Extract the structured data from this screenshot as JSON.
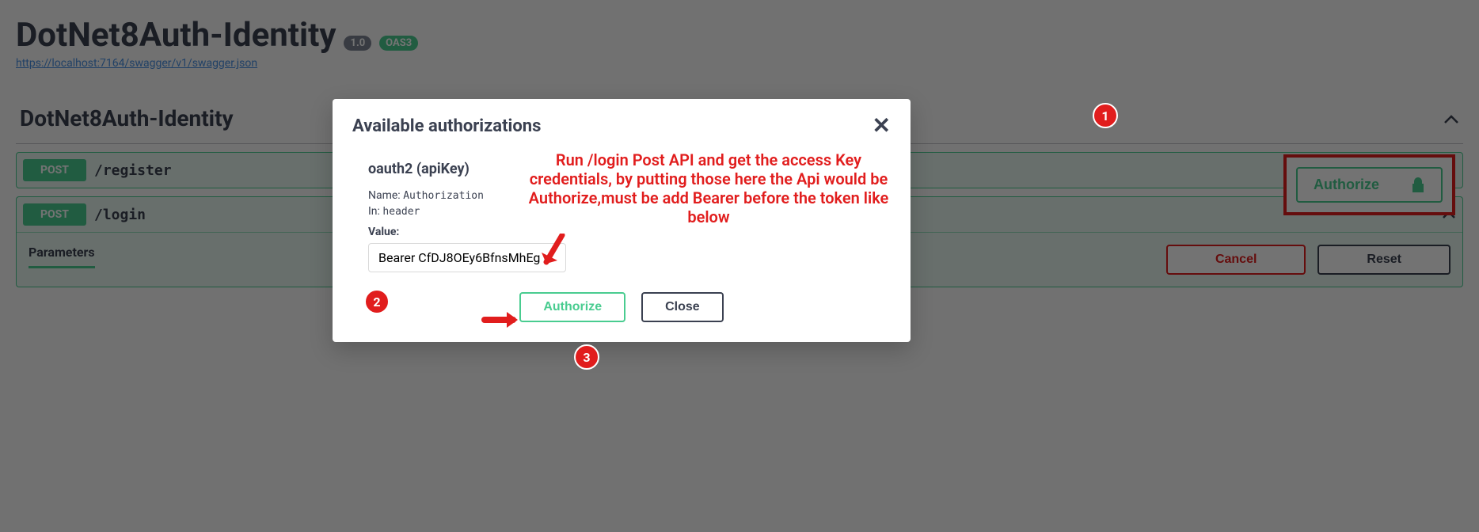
{
  "header": {
    "title": "DotNet8Auth-Identity",
    "version": "1.0",
    "oas": "OAS3",
    "swagger_url": "https://localhost:7164/swagger/v1/swagger.json"
  },
  "authorize_button": {
    "label": "Authorize"
  },
  "section": {
    "title": "DotNet8Auth-Identity"
  },
  "endpoints": [
    {
      "method": "POST",
      "path": "/register",
      "expanded": false
    },
    {
      "method": "POST",
      "path": "/login",
      "expanded": true
    }
  ],
  "parameters": {
    "label": "Parameters",
    "cancel": "Cancel",
    "reset": "Reset"
  },
  "modal": {
    "title": "Available authorizations",
    "scheme_title": "oauth2 (apiKey)",
    "name_label": "Name:",
    "name_value": "Authorization",
    "in_label": "In:",
    "in_value": "header",
    "value_label": "Value:",
    "value_input": "Bearer CfDJ8OEy6BfnsMhEg",
    "authorize": "Authorize",
    "close": "Close"
  },
  "annotations": {
    "text": "Run /login Post API and get the access Key credentials, by putting those here the Api would be Authorize,must be add Bearer before the token like below",
    "circle1": "1",
    "circle2": "2",
    "circle3": "3"
  }
}
